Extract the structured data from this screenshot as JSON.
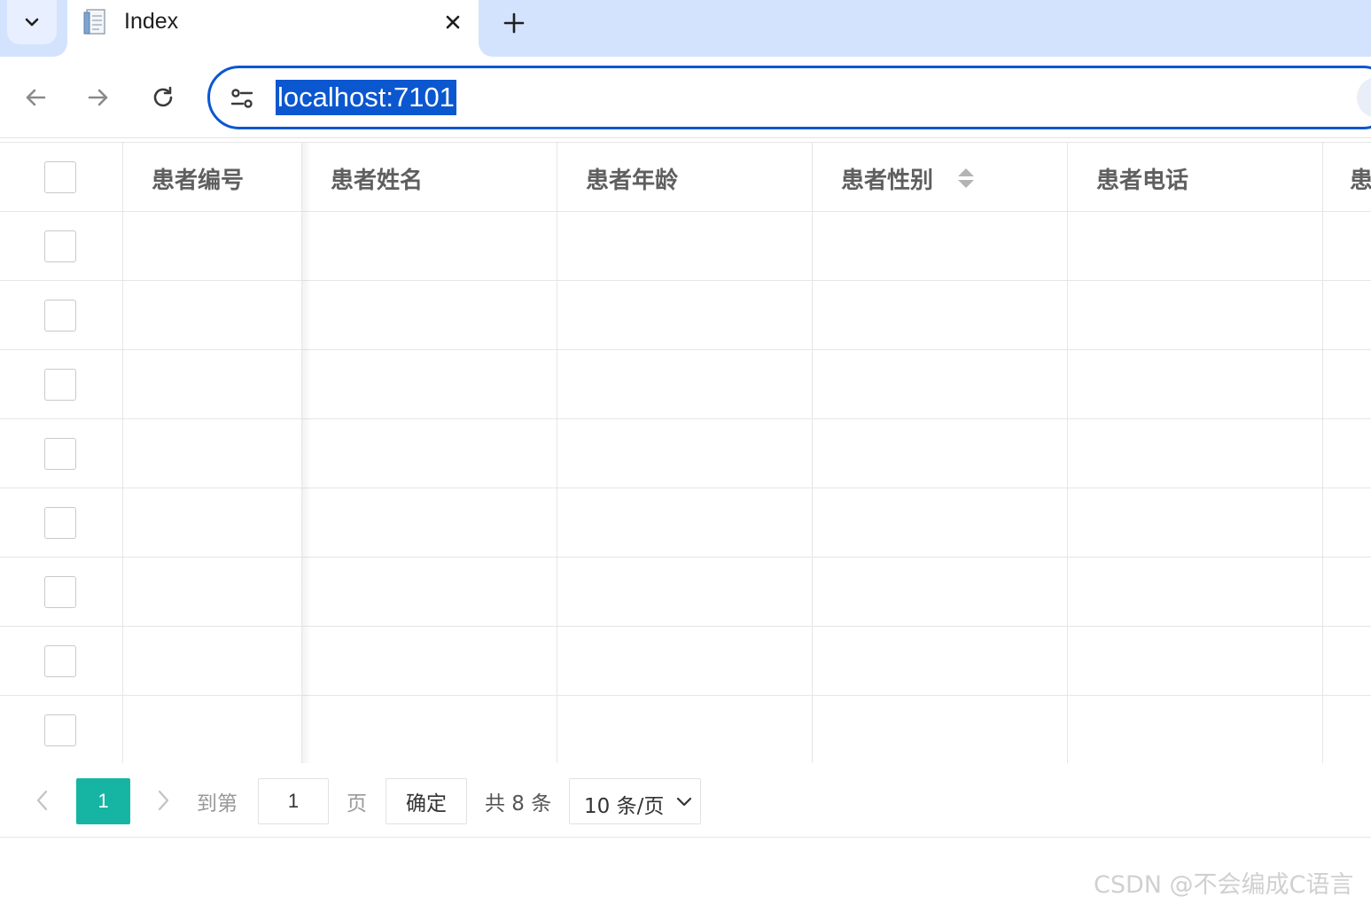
{
  "browser": {
    "tab": {
      "title": "Index"
    },
    "address_bar": {
      "url": "localhost:7101"
    }
  },
  "table": {
    "columns": [
      "患者编号",
      "患者姓名",
      "患者年龄",
      "患者性别",
      "患者电话",
      "患"
    ],
    "sortable_column": "患者性别",
    "row_count": 8
  },
  "pagination": {
    "current_page": "1",
    "goto_label": "到第",
    "goto_value": "1",
    "page_unit": "页",
    "confirm_label": "确定",
    "total_text": "共 8 条",
    "page_size": "10 条/页"
  },
  "watermark": "CSDN @不会编成C语言",
  "icons": {
    "tab_search": "chevron-down-icon",
    "favicon": "document-icon",
    "tab_close": "close-icon",
    "new_tab": "plus-icon",
    "back": "arrow-left-icon",
    "forward": "arrow-right-icon",
    "reload": "reload-icon",
    "site_info": "tune-icon",
    "sort": "sort-icon",
    "prev": "chevron-left-icon",
    "next": "chevron-right-icon",
    "page_size_caret": "chevron-down-icon"
  },
  "colors": {
    "tab_strip": "#d3e3fd",
    "omnibox_border": "#0b57d0",
    "url_selection": "#0b57d0",
    "pager_active": "#16b5a3"
  }
}
